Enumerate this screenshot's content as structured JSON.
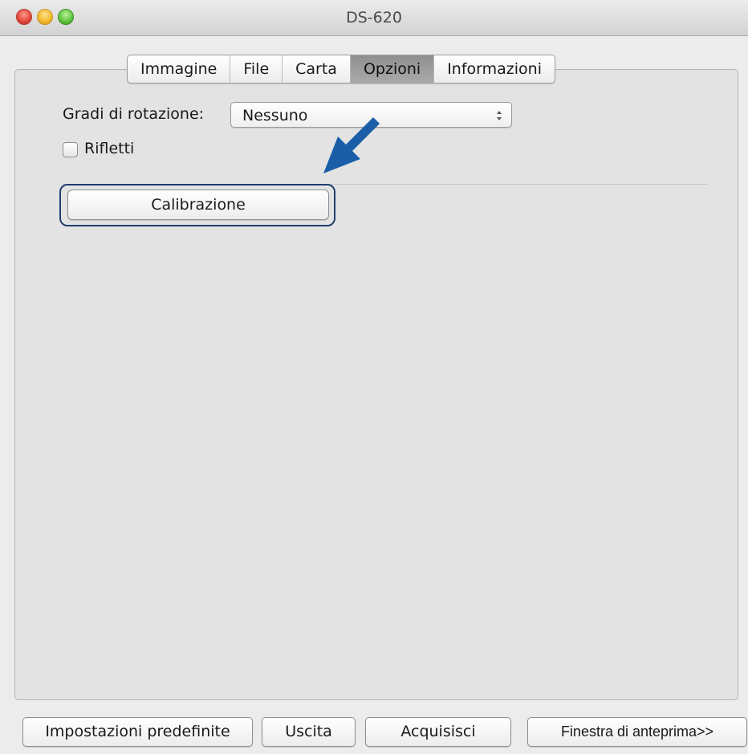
{
  "window": {
    "title": "DS-620"
  },
  "tabs": [
    {
      "label": "Immagine",
      "selected": false
    },
    {
      "label": "File",
      "selected": false
    },
    {
      "label": "Carta",
      "selected": false
    },
    {
      "label": "Opzioni",
      "selected": true
    },
    {
      "label": "Informazioni",
      "selected": false
    }
  ],
  "options": {
    "rotation_label": "Gradi di rotazione:",
    "rotation_value": "Nessuno",
    "mirror_label": "Rifletti",
    "mirror_checked": false,
    "calibration_label": "Calibrazione"
  },
  "footer": {
    "defaults_label": "Impostazioni predefinite",
    "exit_label": "Uscita",
    "scan_label": "Acquisisci",
    "preview_label": "Finestra di anteprima>>"
  },
  "colors": {
    "annotation_arrow": "#1a5ea8",
    "focus_ring": "#1f3f6e",
    "selected_tab": "#9a9a9a"
  }
}
